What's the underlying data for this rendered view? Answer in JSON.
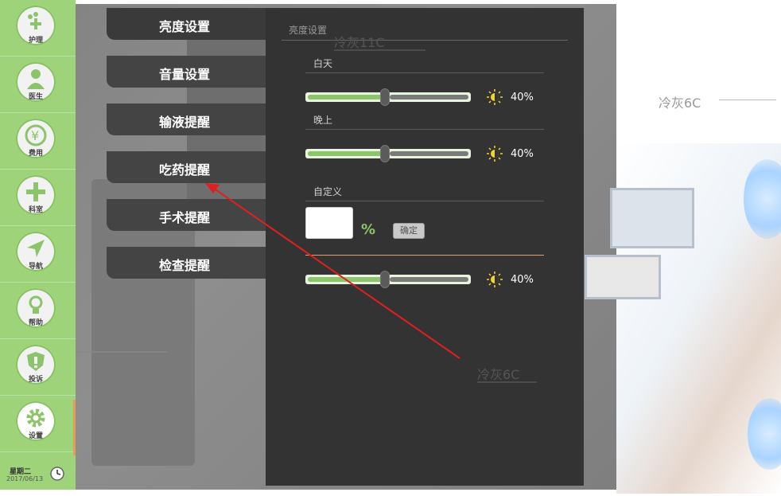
{
  "sidebar": {
    "items": [
      {
        "label": "护理",
        "icon": "nursing-icon"
      },
      {
        "label": "医生",
        "icon": "doctor-icon"
      },
      {
        "label": "费用",
        "icon": "yen-icon"
      },
      {
        "label": "科室",
        "icon": "department-icon"
      },
      {
        "label": "导航",
        "icon": "navigation-icon"
      },
      {
        "label": "帮助",
        "icon": "help-icon"
      },
      {
        "label": "投诉",
        "icon": "complaint-icon"
      },
      {
        "label": "设置",
        "icon": "gear-icon"
      }
    ],
    "active": "设置",
    "weekday": "星期二",
    "date": "2017/06/13"
  },
  "menu": {
    "items": [
      "亮度设置",
      "音量设置",
      "输液提醒",
      "吃药提醒",
      "手术提醒",
      "检查提醒"
    ]
  },
  "panel": {
    "title": "亮度设置",
    "day_label": "白天",
    "day_value": "40%",
    "day_level": 0.48,
    "night_label": "晚上",
    "night_value": "40%",
    "night_level": 0.48,
    "custom_label": "自定义",
    "custom_input_value": "",
    "custom_unit": "%",
    "confirm_label": "确定",
    "custom_slider_value": "40%",
    "custom_level": 0.48
  },
  "annotations": {
    "top": "冷灰11C",
    "right": "冷灰6C",
    "bottom": "冷灰6C"
  },
  "colors": {
    "sidebar_green": "#9ed37a",
    "panel_bg": "#333333",
    "accent_green": "#8bc46b",
    "annotation_arrow": "#e02020"
  }
}
